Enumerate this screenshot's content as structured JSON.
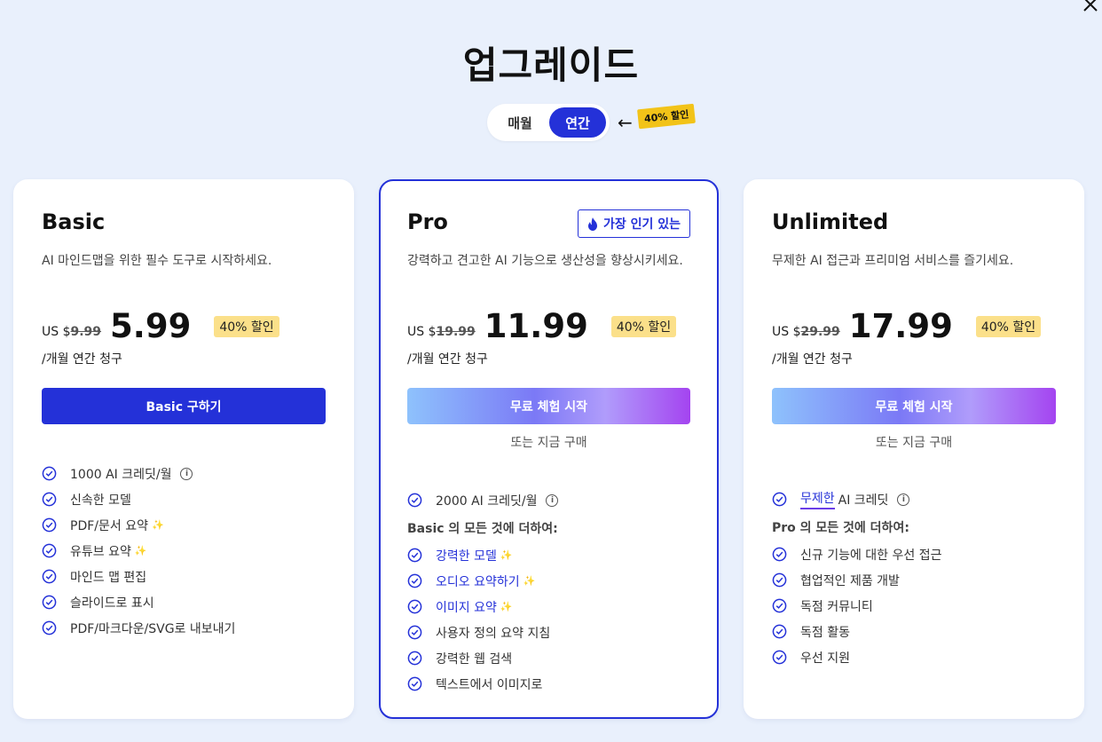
{
  "page": {
    "title": "업그레이드"
  },
  "billing_toggle": {
    "monthly_label": "매월",
    "annual_label": "연간",
    "selected": "연간",
    "discount_sticker": "40% 할인"
  },
  "colors": {
    "accent": "#2431d8",
    "background": "#e9f0fc",
    "discount_badge": "#fbe08a",
    "sticker": "#f2c318"
  },
  "plans": [
    {
      "name": "Basic",
      "description": "AI 마인드맵을 위한 필수 도구로 시작하세요.",
      "currency_prefix": "US $",
      "old_price": "9.99",
      "price": "5.99",
      "discount": "40% 할인",
      "billing_note": "/개월 연간 청구",
      "cta_label": "Basic 구하기",
      "features": [
        {
          "text": "1000 AI 크레딧/월",
          "info": true
        },
        {
          "text": "신속한 모델"
        },
        {
          "text": "PDF/문서 요약",
          "sparkle": true
        },
        {
          "text": "유튜브 요약",
          "sparkle": true
        },
        {
          "text": "마인드 맵 편집"
        },
        {
          "text": "슬라이드로 표시"
        },
        {
          "text": "PDF/마크다운/SVG로 내보내기"
        }
      ]
    },
    {
      "name": "Pro",
      "badge": "가장 인기 있는",
      "description": "강력하고 견고한 AI 기능으로 생산성을 향상시키세요.",
      "currency_prefix": "US $",
      "old_price": "19.99",
      "price": "11.99",
      "discount": "40% 할인",
      "billing_note": "/개월 연간 청구",
      "cta_label": "무료 체험 시작",
      "buy_now_label": "또는 지금 구매",
      "credits_feature": "2000 AI 크레딧/월",
      "section_head": "Basic 의 모든 것에 더하여:",
      "features": [
        {
          "text": "강력한 모델",
          "sparkle": true,
          "highlight": true
        },
        {
          "text": "오디오 요약하기",
          "sparkle": true,
          "highlight": true
        },
        {
          "text": "이미지 요약",
          "sparkle": true,
          "highlight": true
        },
        {
          "text": "사용자 정의 요약 지침"
        },
        {
          "text": "강력한 웹 검색"
        },
        {
          "text": "텍스트에서 이미지로"
        }
      ]
    },
    {
      "name": "Unlimited",
      "description": "무제한 AI 접근과 프리미엄 서비스를 즐기세요.",
      "currency_prefix": "US $",
      "old_price": "29.99",
      "price": "17.99",
      "discount": "40% 할인",
      "billing_note": "/개월 연간 청구",
      "cta_label": "무료 체험 시작",
      "buy_now_label": "또는 지금 구매",
      "credits_emphasis": "무제한",
      "credits_rest": "AI 크레딧",
      "section_head": "Pro 의 모든 것에 더하여:",
      "features": [
        {
          "text": "신규 기능에 대한 우선 접근"
        },
        {
          "text": "협업적인 제품 개발"
        },
        {
          "text": "독점 커뮤니티"
        },
        {
          "text": "독점 활동"
        },
        {
          "text": "우선 지원"
        }
      ]
    }
  ],
  "icons": {
    "close": "close-icon",
    "check": "check-circle-icon",
    "info": "info-icon",
    "sparkle": "sparkle-icon",
    "fire": "fire-icon",
    "arrow": "arrow-left-icon"
  }
}
